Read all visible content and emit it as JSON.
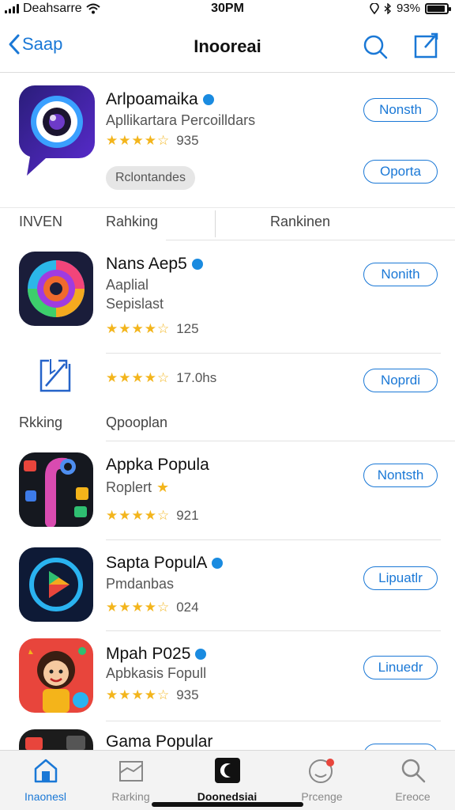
{
  "status_bar": {
    "carrier": "Deahsarre",
    "time": "30PM",
    "battery_text": "93%",
    "battery_level": 0.93
  },
  "nav": {
    "back_label": "Saap",
    "title": "Inooreai"
  },
  "featured": {
    "name": "Arlpoamaika",
    "subtitle": "Apllikartara Percoilldars",
    "rating_count": "935",
    "stars": 4.5,
    "chip": "Rclontandes",
    "button_top": "Nonsth",
    "button_bottom": "Oporta"
  },
  "section1": {
    "label_left": "INVEN",
    "label_mid": "Rahking",
    "label_right": "Rankinen"
  },
  "app1": {
    "name": "Nans Aep5",
    "line1": "Aaplial",
    "line2": "Sepislast",
    "rating_count": "125",
    "stars": 4.5,
    "button": "Nonith"
  },
  "app1b": {
    "rating_count": "17.0hs",
    "stars": 4.5,
    "button": "Noprdi"
  },
  "section2": {
    "label_left": "Rkking",
    "label_mid": "Qpooplan"
  },
  "app2": {
    "name": "Appka Popula",
    "subtitle": "Roplert",
    "rating_count": "921",
    "stars": 4.5,
    "button": "Nontsth"
  },
  "app3": {
    "name": "Sapta PopulA",
    "subtitle": "Pmdanbas",
    "rating_count": "024",
    "stars": 4.5,
    "button": "Lipuatlr"
  },
  "app4": {
    "name": "Mpah P025",
    "subtitle": "Apbkasis  Fopull",
    "rating_count": "935",
    "stars": 4.5,
    "button": "Linuedr"
  },
  "app5": {
    "name": "Gama Popular"
  },
  "tabs": [
    {
      "label": "Inaonesl",
      "icon": "home-icon"
    },
    {
      "label": "Rarking",
      "icon": "ranking-icon"
    },
    {
      "label": "Doonedsiai",
      "icon": "app-icon"
    },
    {
      "label": "Prcenge",
      "icon": "profile-icon"
    },
    {
      "label": "Ereoce",
      "icon": "search-icon"
    }
  ],
  "colors": {
    "accent": "#1a78d6",
    "star": "#f3b51c",
    "verified": "#1a8be0"
  }
}
